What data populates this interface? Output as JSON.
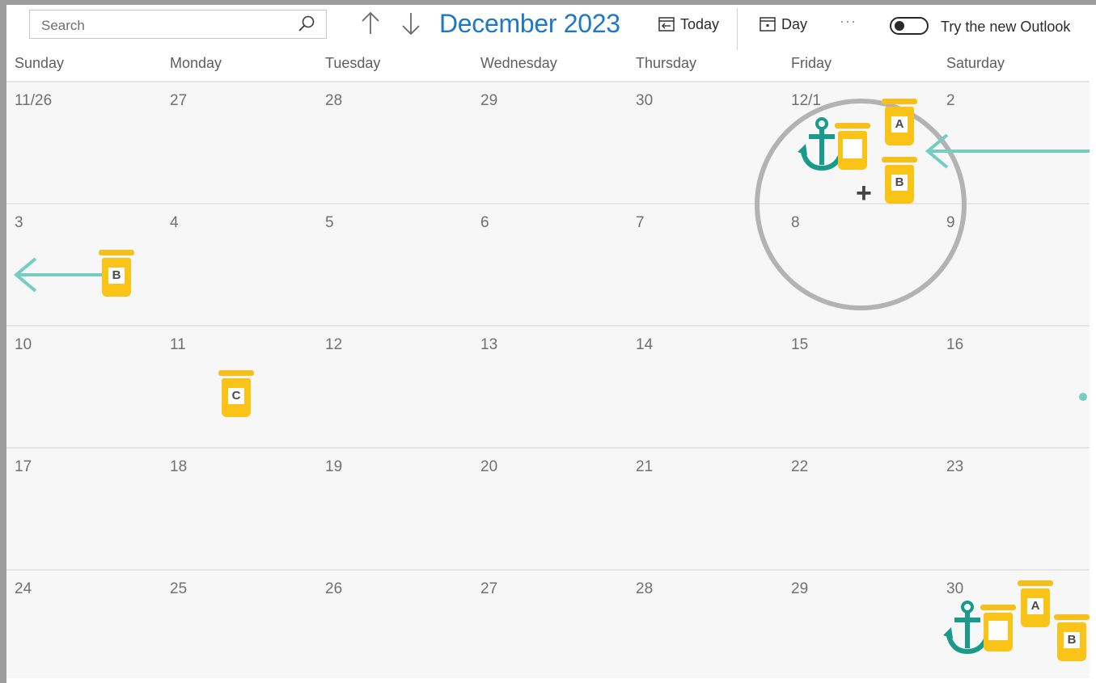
{
  "toolbar": {
    "search_placeholder": "Search",
    "month_title": "December 2023",
    "today_label": "Today",
    "day_label": "Day",
    "more_label": "···",
    "toggle_label": "Try the new Outlook"
  },
  "weekdays": [
    "Sunday",
    "Monday",
    "Tuesday",
    "Wednesday",
    "Thursday",
    "Friday",
    "Saturday"
  ],
  "weeks": [
    [
      "11/26",
      "27",
      "28",
      "29",
      "30",
      "12/1",
      "2"
    ],
    [
      "3",
      "4",
      "5",
      "6",
      "7",
      "8",
      "9"
    ],
    [
      "10",
      "11",
      "12",
      "13",
      "14",
      "15",
      "16"
    ],
    [
      "17",
      "18",
      "19",
      "20",
      "21",
      "22",
      "23"
    ],
    [
      "24",
      "25",
      "26",
      "27",
      "28",
      "29",
      "30"
    ]
  ],
  "annotations": {
    "jar_a": "A",
    "jar_b": "B",
    "jar_c": "C",
    "plus": "+",
    "colors": {
      "jar": "#f9c417",
      "anchor": "#1a9a8a",
      "arrow": "#74cdc2",
      "accent": "#1f77c9"
    },
    "icons": [
      "anchor-icon",
      "jar-icon",
      "arrow-left-icon",
      "plus-icon",
      "magnifier-circle"
    ]
  }
}
